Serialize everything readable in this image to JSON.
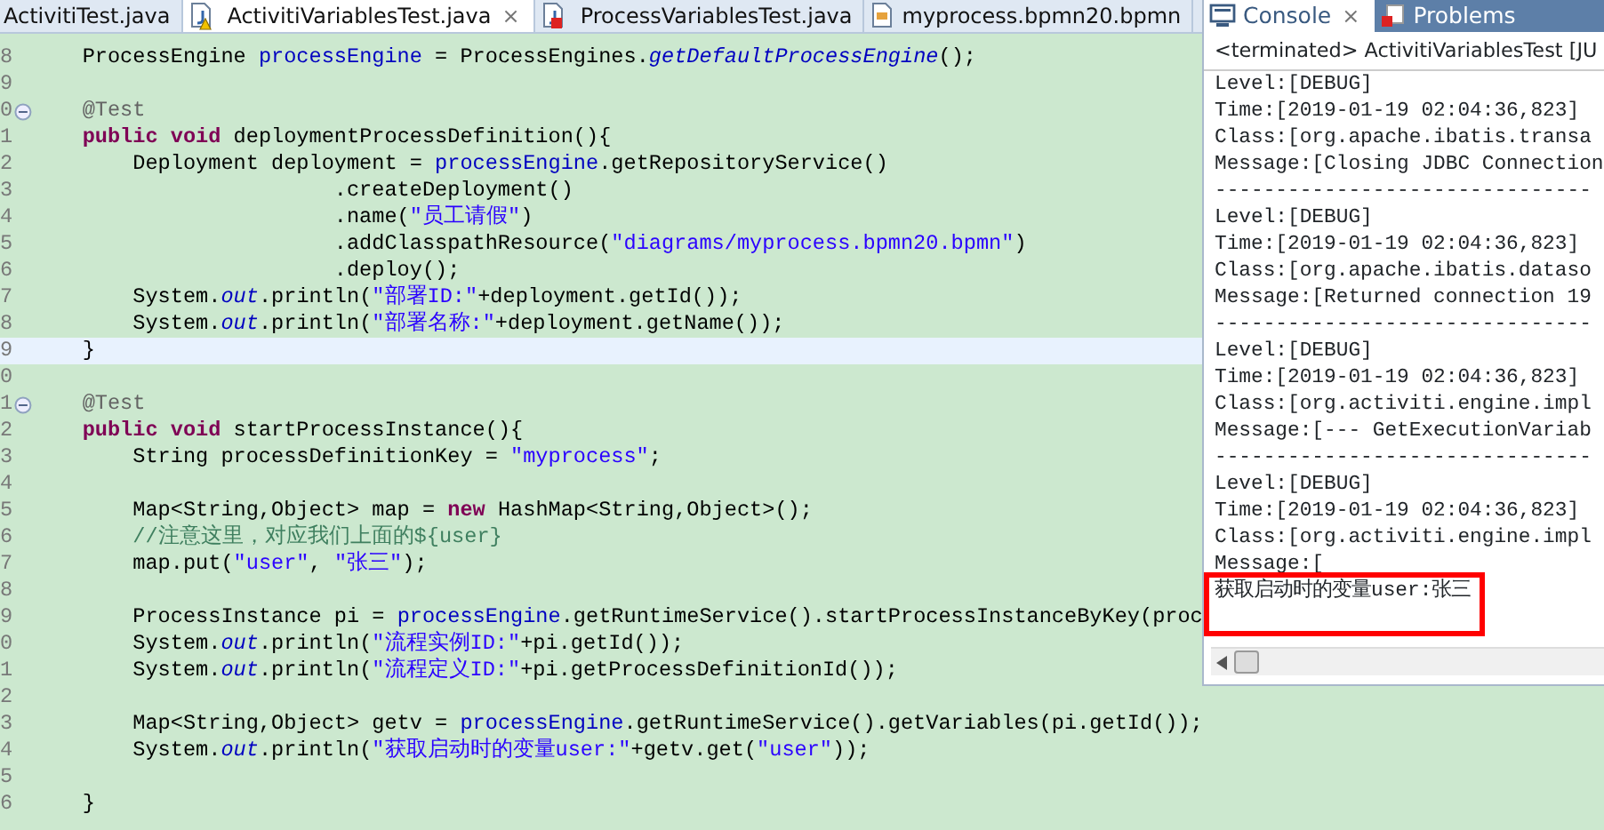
{
  "editor_tabs": [
    {
      "label": "ActivitiTest.java",
      "selected": false,
      "kind": "none",
      "warning": false,
      "error": false,
      "closable": false
    },
    {
      "label": "ActivitiVariablesTest.java",
      "selected": true,
      "kind": "java",
      "warning": true,
      "error": false,
      "closable": true
    },
    {
      "label": "ProcessVariablesTest.java",
      "selected": false,
      "kind": "java",
      "warning": false,
      "error": true,
      "closable": false
    },
    {
      "label": "myprocess.bpmn20.bpmn",
      "selected": false,
      "kind": "bpmn",
      "warning": false,
      "error": false,
      "closable": false
    }
  ],
  "editor_close": "×",
  "code_lines": [
    {
      "number": "8",
      "fold_marker": false,
      "current": false,
      "tokens": [
        {
          "t": "    ProcessEngine ",
          "kind": "plain"
        },
        {
          "t": "processEngine",
          "kind": "field"
        },
        {
          "t": " = ProcessEngines.",
          "kind": "plain"
        },
        {
          "t": "getDefaultProcessEngine",
          "kind": "static"
        },
        {
          "t": "();",
          "kind": "plain"
        }
      ]
    },
    {
      "number": "9",
      "fold_marker": false,
      "current": false
    },
    {
      "number": "0",
      "fold_marker": true,
      "current": false,
      "tokens": [
        {
          "t": "    @Test",
          "kind": "annotation"
        }
      ]
    },
    {
      "number": "1",
      "fold_marker": false,
      "current": false,
      "tokens": [
        {
          "t": "    public void",
          "kind": "keyword"
        },
        {
          "t": " deploymentProcessDefinition(){",
          "kind": "plain"
        }
      ]
    },
    {
      "number": "2",
      "fold_marker": false,
      "current": false,
      "tokens": [
        {
          "t": "        Deployment deployment = ",
          "kind": "plain"
        },
        {
          "t": "processEngine",
          "kind": "field"
        },
        {
          "t": ".getRepositoryService()",
          "kind": "plain"
        }
      ]
    },
    {
      "number": "3",
      "fold_marker": false,
      "current": false,
      "tokens": [
        {
          "t": "                        .createDeployment()",
          "kind": "plain"
        }
      ]
    },
    {
      "number": "4",
      "fold_marker": false,
      "current": false,
      "tokens": [
        {
          "t": "                        .name(",
          "kind": "plain"
        },
        {
          "t": "\"员工请假\"",
          "kind": "string"
        },
        {
          "t": ")",
          "kind": "plain"
        }
      ]
    },
    {
      "number": "5",
      "fold_marker": false,
      "current": false,
      "tokens": [
        {
          "t": "                        .addClasspathResource(",
          "kind": "plain"
        },
        {
          "t": "\"diagrams/myprocess.bpmn20.bpmn\"",
          "kind": "string"
        },
        {
          "t": ")",
          "kind": "plain"
        }
      ]
    },
    {
      "number": "6",
      "fold_marker": false,
      "current": false,
      "tokens": [
        {
          "t": "                        .deploy();",
          "kind": "plain"
        }
      ]
    },
    {
      "number": "7",
      "fold_marker": false,
      "current": false,
      "tokens": [
        {
          "t": "        System.",
          "kind": "plain"
        },
        {
          "t": "out",
          "kind": "static"
        },
        {
          "t": ".println(",
          "kind": "plain"
        },
        {
          "t": "\"部署ID:\"",
          "kind": "string"
        },
        {
          "t": "+deployment.getId());",
          "kind": "plain"
        }
      ]
    },
    {
      "number": "8",
      "fold_marker": false,
      "current": false,
      "tokens": [
        {
          "t": "        System.",
          "kind": "plain"
        },
        {
          "t": "out",
          "kind": "static"
        },
        {
          "t": ".println(",
          "kind": "plain"
        },
        {
          "t": "\"部署名称:\"",
          "kind": "string"
        },
        {
          "t": "+deployment.getName());",
          "kind": "plain"
        }
      ]
    },
    {
      "number": "9",
      "fold_marker": false,
      "current": true,
      "tokens": [
        {
          "t": "    }",
          "kind": "plain"
        }
      ]
    },
    {
      "number": "0",
      "fold_marker": false,
      "current": false
    },
    {
      "number": "1",
      "fold_marker": true,
      "current": false,
      "tokens": [
        {
          "t": "    @Test",
          "kind": "annotation"
        }
      ]
    },
    {
      "number": "2",
      "fold_marker": false,
      "current": false,
      "tokens": [
        {
          "t": "    public void",
          "kind": "keyword"
        },
        {
          "t": " startProcessInstance(){",
          "kind": "plain"
        }
      ]
    },
    {
      "number": "3",
      "fold_marker": false,
      "current": false,
      "tokens": [
        {
          "t": "        String processDefinitionKey = ",
          "kind": "plain"
        },
        {
          "t": "\"myprocess\"",
          "kind": "string"
        },
        {
          "t": ";",
          "kind": "plain"
        }
      ]
    },
    {
      "number": "4",
      "fold_marker": false,
      "current": false
    },
    {
      "number": "5",
      "fold_marker": false,
      "current": false,
      "tokens": [
        {
          "t": "        Map<String,Object> map = ",
          "kind": "plain"
        },
        {
          "t": "new",
          "kind": "keyword"
        },
        {
          "t": " HashMap<String,Object>();",
          "kind": "plain"
        }
      ]
    },
    {
      "number": "6",
      "fold_marker": false,
      "current": false,
      "tokens": [
        {
          "t": "        //注意这里，对应我们上面的${user}",
          "kind": "comment"
        }
      ]
    },
    {
      "number": "7",
      "fold_marker": false,
      "current": false,
      "tokens": [
        {
          "t": "        map.put(",
          "kind": "plain"
        },
        {
          "t": "\"user\"",
          "kind": "string"
        },
        {
          "t": ", ",
          "kind": "plain"
        },
        {
          "t": "\"张三\"",
          "kind": "string"
        },
        {
          "t": ");",
          "kind": "plain"
        }
      ]
    },
    {
      "number": "8",
      "fold_marker": false,
      "current": false
    },
    {
      "number": "9",
      "fold_marker": false,
      "current": false,
      "tokens": [
        {
          "t": "        ProcessInstance pi = ",
          "kind": "plain"
        },
        {
          "t": "processEngine",
          "kind": "field"
        },
        {
          "t": ".getRuntimeService().startProcessInstanceByKey(proc",
          "kind": "plain"
        }
      ]
    },
    {
      "number": "0",
      "fold_marker": false,
      "current": false,
      "tokens": [
        {
          "t": "        System.",
          "kind": "plain"
        },
        {
          "t": "out",
          "kind": "static"
        },
        {
          "t": ".println(",
          "kind": "plain"
        },
        {
          "t": "\"流程实例ID:\"",
          "kind": "string"
        },
        {
          "t": "+pi.getId());",
          "kind": "plain"
        }
      ]
    },
    {
      "number": "1",
      "fold_marker": false,
      "current": false,
      "tokens": [
        {
          "t": "        System.",
          "kind": "plain"
        },
        {
          "t": "out",
          "kind": "static"
        },
        {
          "t": ".println(",
          "kind": "plain"
        },
        {
          "t": "\"流程定义ID:\"",
          "kind": "string"
        },
        {
          "t": "+pi.getProcessDefinitionId());",
          "kind": "plain"
        }
      ]
    },
    {
      "number": "2",
      "fold_marker": false,
      "current": false
    },
    {
      "number": "3",
      "fold_marker": false,
      "current": false,
      "tokens": [
        {
          "t": "        Map<String,Object> getv = ",
          "kind": "plain"
        },
        {
          "t": "processEngine",
          "kind": "field"
        },
        {
          "t": ".getRuntimeService().getVariables(pi.getId());",
          "kind": "plain"
        }
      ]
    },
    {
      "number": "4",
      "fold_marker": false,
      "current": false,
      "tokens": [
        {
          "t": "        System.",
          "kind": "plain"
        },
        {
          "t": "out",
          "kind": "static"
        },
        {
          "t": ".println(",
          "kind": "plain"
        },
        {
          "t": "\"获取启动时的变量user:\"",
          "kind": "string"
        },
        {
          "t": "+getv.get(",
          "kind": "plain"
        },
        {
          "t": "\"user\"",
          "kind": "string"
        },
        {
          "t": "));",
          "kind": "plain"
        }
      ]
    },
    {
      "number": "5",
      "fold_marker": false,
      "current": false
    },
    {
      "number": "6",
      "fold_marker": false,
      "current": false,
      "tokens": [
        {
          "t": "    }",
          "kind": "plain"
        }
      ]
    }
  ],
  "console": {
    "tabs": [
      {
        "label": "Console",
        "selected": true,
        "closable": true
      },
      {
        "label": "Problems",
        "selected": false,
        "closable": false
      }
    ],
    "close": "×",
    "status": "<terminated> ActivitiVariablesTest [JU",
    "lines": [
      {
        "text": "Level:[DEBUG]",
        "highlighted": false
      },
      {
        "text": "Time:[2019-01-19 02:04:36,823]",
        "highlighted": false
      },
      {
        "text": "Class:[org.apache.ibatis.transa",
        "highlighted": false
      },
      {
        "text": "Message:[Closing JDBC Connection",
        "highlighted": false
      },
      {
        "text": "-------------------------------",
        "highlighted": false
      },
      {
        "text": "Level:[DEBUG]",
        "highlighted": false
      },
      {
        "text": "Time:[2019-01-19 02:04:36,823]",
        "highlighted": false
      },
      {
        "text": "Class:[org.apache.ibatis.dataso",
        "highlighted": false
      },
      {
        "text": "Message:[Returned connection 19",
        "highlighted": false
      },
      {
        "text": "-------------------------------",
        "highlighted": false
      },
      {
        "text": "Level:[DEBUG]",
        "highlighted": false
      },
      {
        "text": "Time:[2019-01-19 02:04:36,823]",
        "highlighted": false
      },
      {
        "text": "Class:[org.activiti.engine.impl",
        "highlighted": false
      },
      {
        "text": "Message:[--- GetExecutionVariab",
        "highlighted": false
      },
      {
        "text": "-------------------------------",
        "highlighted": false
      },
      {
        "text": "Level:[DEBUG]",
        "highlighted": false
      },
      {
        "text": "Time:[2019-01-19 02:04:36,823]",
        "highlighted": false
      },
      {
        "text": "Class:[org.activiti.engine.impl",
        "highlighted": false
      },
      {
        "text": "Message:[",
        "highlighted": false
      },
      {
        "text": "获取启动时的变量user:张三",
        "highlighted": true
      }
    ]
  }
}
